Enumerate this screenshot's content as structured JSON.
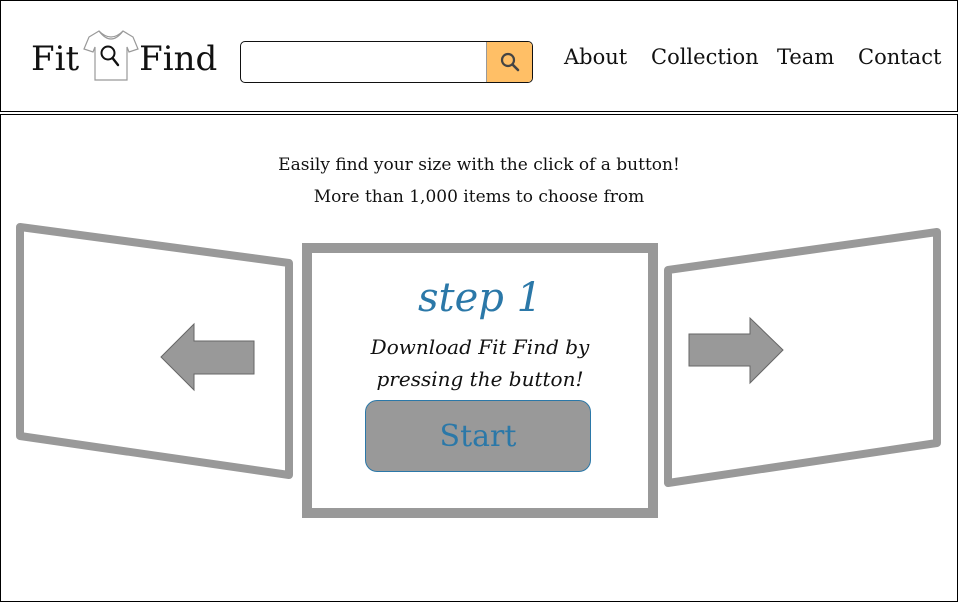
{
  "header": {
    "logo": {
      "word1": "Fit",
      "word2": "Find"
    },
    "search": {
      "placeholder": "",
      "value": ""
    },
    "nav": [
      {
        "label": "About"
      },
      {
        "label": "Collection"
      },
      {
        "label": "Team"
      },
      {
        "label": "Contact"
      }
    ]
  },
  "hero": {
    "line1": "Easily find your size with the click of a button!",
    "line2": "More than 1,000 items to choose from"
  },
  "carousel": {
    "step_title": "step 1",
    "step_description": "Download Fit Find by pressing the button!",
    "start_label": "Start"
  },
  "colors": {
    "accent_search": "#ffbf66",
    "accent_blue": "#2b78a8",
    "panel_gray": "#999999"
  },
  "icons": {
    "logo": "tshirt-magnifier-icon",
    "search": "search-icon",
    "prev": "arrow-left-icon",
    "next": "arrow-right-icon"
  }
}
